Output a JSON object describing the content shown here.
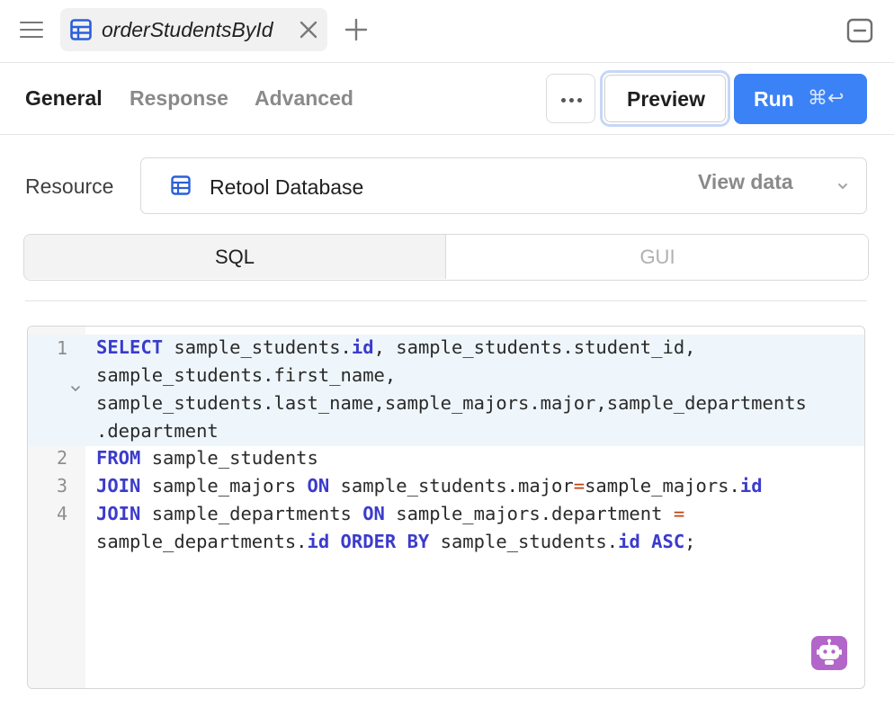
{
  "tabbar": {
    "tab_title": "orderStudentsById",
    "menu_icon": "hamburger-icon",
    "add_icon": "plus-icon",
    "collapse_icon": "collapse-panel-icon"
  },
  "editor_tabs": {
    "general": "General",
    "response": "Response",
    "advanced": "Advanced"
  },
  "actions": {
    "more_icon": "ellipsis-icon",
    "preview": "Preview",
    "run": "Run",
    "run_shortcut": "⌘↩"
  },
  "resource": {
    "label": "Resource",
    "name": "Retool Database",
    "view_data": "View data"
  },
  "mode": {
    "sql": "SQL",
    "gui": "GUI",
    "selected": "SQL"
  },
  "code": {
    "line_numbers": [
      "1",
      "2",
      "3",
      "4"
    ],
    "lines": [
      [
        {
          "t": "SELECT",
          "k": "kw"
        },
        {
          "t": " sample_students."
        },
        {
          "t": "id",
          "k": "kw"
        },
        {
          "t": ", sample_students.student_id,"
        }
      ],
      [
        {
          "t": "sample_students.first_name,"
        }
      ],
      [
        {
          "t": "sample_students.last_name,sample_majors.major,sample_departments"
        }
      ],
      [
        {
          "t": ".department"
        }
      ],
      [
        {
          "t": "FROM",
          "k": "kw"
        },
        {
          "t": " sample_students"
        }
      ],
      [
        {
          "t": "JOIN",
          "k": "kw"
        },
        {
          "t": " sample_majors "
        },
        {
          "t": "ON",
          "k": "kw"
        },
        {
          "t": " sample_students.major"
        },
        {
          "t": "=",
          "k": "op"
        },
        {
          "t": "sample_majors."
        },
        {
          "t": "id",
          "k": "kw"
        }
      ],
      [
        {
          "t": "JOIN",
          "k": "kw"
        },
        {
          "t": " sample_departments "
        },
        {
          "t": "ON",
          "k": "kw"
        },
        {
          "t": " sample_majors.department "
        },
        {
          "t": "=",
          "k": "op"
        }
      ],
      [
        {
          "t": "sample_departments."
        },
        {
          "t": "id",
          "k": "kw"
        },
        {
          "t": " "
        },
        {
          "t": "ORDER BY",
          "k": "kw"
        },
        {
          "t": " sample_students."
        },
        {
          "t": "id",
          "k": "kw"
        },
        {
          "t": " "
        },
        {
          "t": "ASC",
          "k": "kw"
        },
        {
          "t": ";"
        }
      ]
    ]
  },
  "colors": {
    "run_button": "#3b82f6",
    "keyword": "#3b3bcc",
    "operator": "#c2410c",
    "ai_assistant": "#b266c9"
  },
  "assistant_icon": "robot-icon"
}
